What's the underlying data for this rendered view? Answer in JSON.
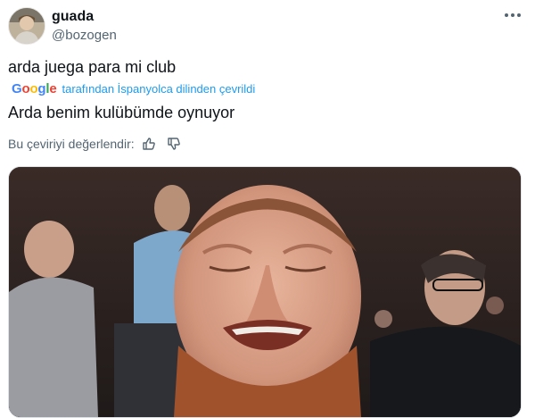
{
  "user": {
    "display_name": "guada",
    "handle": "@bozogen"
  },
  "tweet": {
    "text": "arda juega para mi club",
    "translated_by": "tarafından İspanyolca dilinden çevrildi",
    "translation": "Arda benim kulübümde oynuyor",
    "rate_label": "Bu çeviriyi değerlendir:"
  },
  "google_logo": "Google",
  "icons": {
    "more": "more-horizontal-icon",
    "thumb_up": "thumb-up-icon",
    "thumb_down": "thumb-down-icon"
  },
  "colors": {
    "link": "#1d9bf0",
    "secondary_text": "#536471",
    "primary_text": "#0f1419"
  }
}
